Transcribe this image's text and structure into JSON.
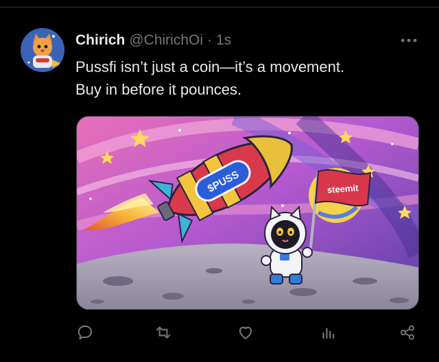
{
  "tweet": {
    "author": {
      "name": "Chirich",
      "handle": "@ChirichOi",
      "separator": "·",
      "time": "1s"
    },
    "text_lines": [
      "Pussfi isn’t just a coin—it’s a movement.",
      "Buy in before it pounces."
    ],
    "image": {
      "rocket_label": "$PUSS",
      "flag_label": "steemit"
    },
    "icons": {
      "more": "more-icon",
      "reply": "reply-icon",
      "retweet": "retweet-icon",
      "like": "like-icon",
      "views": "views-icon",
      "share": "share-icon"
    },
    "colors": {
      "background": "#000000",
      "text": "#e7e9ea",
      "secondary": "#71767b",
      "divider": "#2f3336"
    }
  }
}
